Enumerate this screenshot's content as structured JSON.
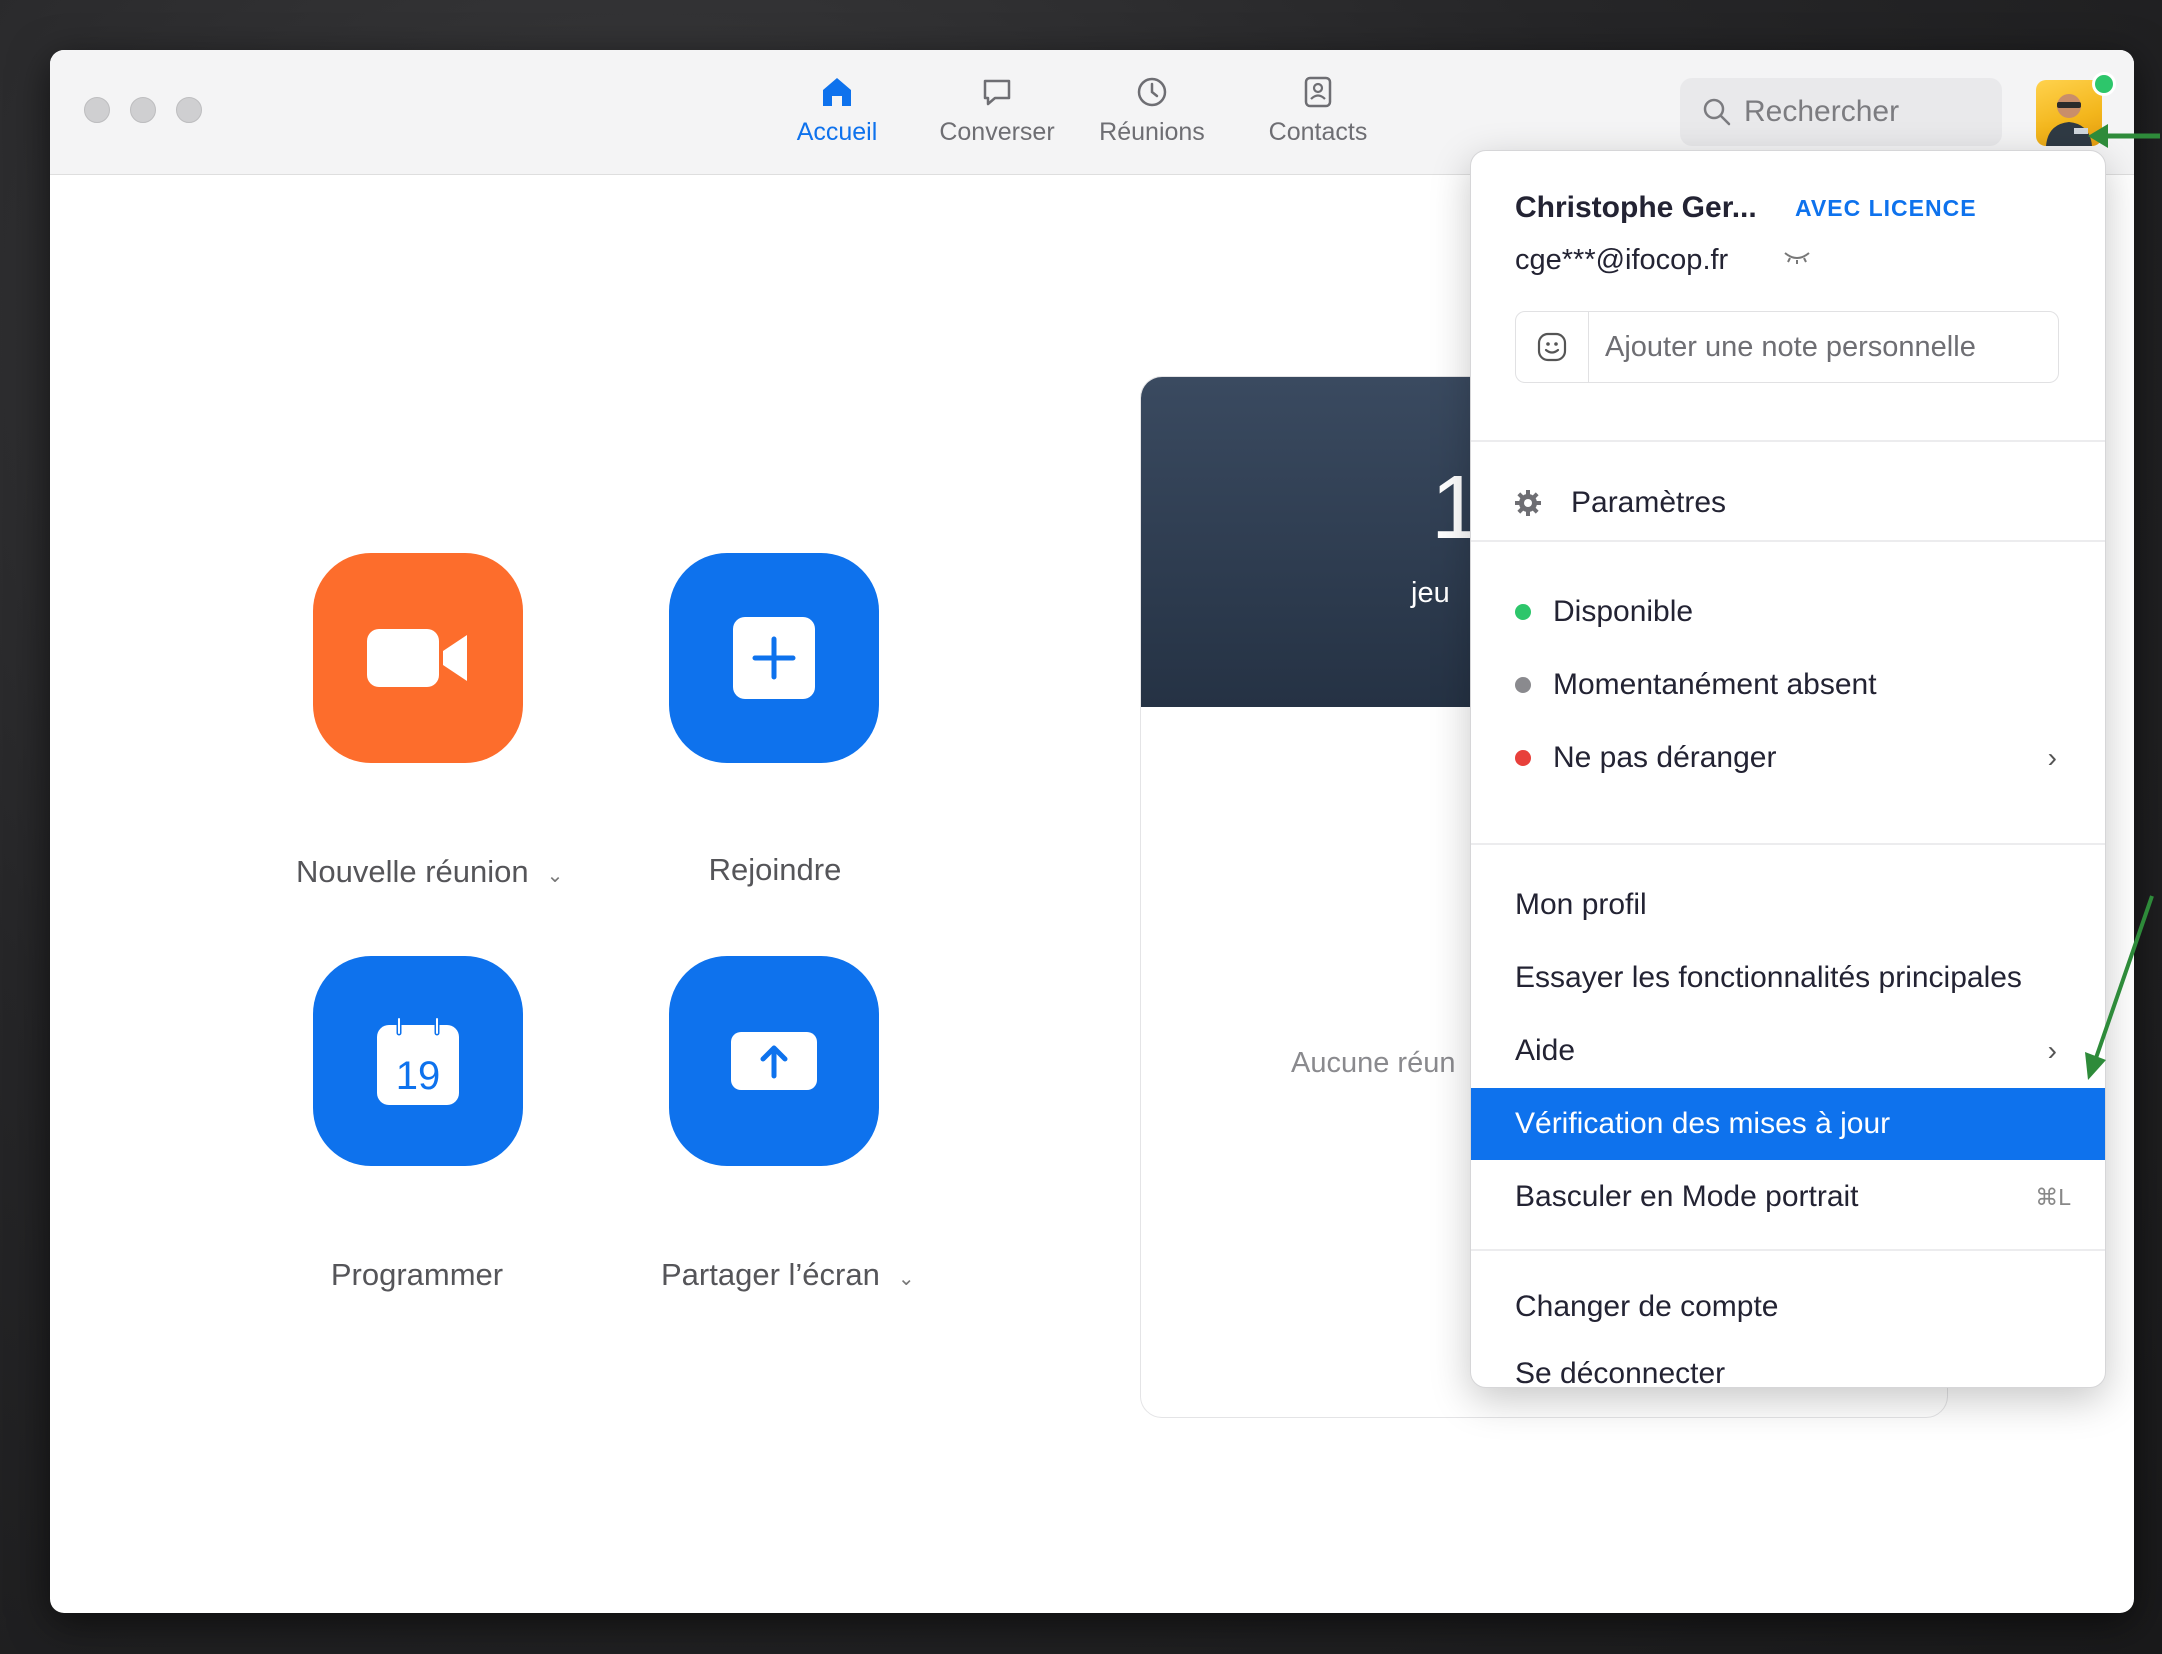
{
  "nav": {
    "tabs": [
      {
        "label": "Accueil",
        "icon": "home-icon",
        "active": true
      },
      {
        "label": "Converser",
        "icon": "chat-icon",
        "active": false
      },
      {
        "label": "Réunions",
        "icon": "clock-icon",
        "active": false
      },
      {
        "label": "Contacts",
        "icon": "contacts-icon",
        "active": false
      }
    ],
    "search_placeholder": "Rechercher"
  },
  "home": {
    "tiles": [
      {
        "label": "Nouvelle réunion",
        "icon": "video-camera-icon",
        "color": "#fd6d2c",
        "has_dropdown": true
      },
      {
        "label": "Rejoindre",
        "icon": "plus-icon",
        "color": "#0e72ed",
        "has_dropdown": false
      },
      {
        "label": "Programmer",
        "icon": "calendar-icon",
        "calendar_day": "19",
        "color": "#0e72ed",
        "has_dropdown": false
      },
      {
        "label": "Partager l’écran",
        "icon": "share-screen-icon",
        "color": "#0e72ed",
        "has_dropdown": true
      }
    ]
  },
  "panel": {
    "time_partial": "1",
    "date_partial": "jeu",
    "empty_partial": "Aucune réun"
  },
  "menu": {
    "name": "Christophe Ger...",
    "badge": "AVEC LICENCE",
    "email": "cge***@ifocop.fr",
    "note_placeholder": "Ajouter une note personnelle",
    "settings": "Paramètres",
    "status": [
      {
        "label": "Disponible",
        "color": "#2dc66b",
        "has_submenu": false
      },
      {
        "label": "Momentanément absent",
        "color": "#8a8a8e",
        "has_submenu": false
      },
      {
        "label": "Ne pas déranger",
        "color": "#e8403b",
        "has_submenu": true
      }
    ],
    "items": [
      {
        "label": "Mon profil"
      },
      {
        "label": "Essayer les fonctionnalités principales"
      },
      {
        "label": "Aide",
        "has_submenu": true
      },
      {
        "label": "Vérification des mises à jour",
        "highlighted": true
      },
      {
        "label": "Basculer en Mode portrait",
        "shortcut": "⌘L"
      }
    ],
    "account_items": [
      {
        "label": "Changer de compte"
      },
      {
        "label": "Se déconnecter"
      }
    ]
  },
  "colors": {
    "accent": "#0e72ed",
    "orange": "#fd6d2c",
    "annotation_arrow": "#2e8b3a"
  }
}
